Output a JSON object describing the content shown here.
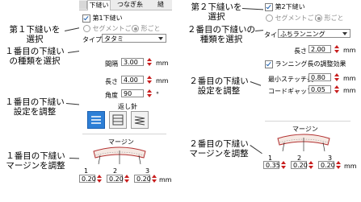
{
  "callouts": {
    "left_1": [
      "第１下縫いを",
      "選択"
    ],
    "left_2": [
      "１番目の下縫い",
      "の種類を選択"
    ],
    "left_3": [
      "１番目の下縫い",
      "設定を調整"
    ],
    "left_4": [
      "１番目の下縫い",
      "マージンを調整"
    ],
    "right_1": [
      "第２下縫いを",
      "選択"
    ],
    "right_2": [
      "２番目の下縫いの",
      "種類を選択"
    ],
    "right_3": [
      "２番目の下縫い",
      "設定を調整"
    ],
    "right_4": [
      "２番目の下縫い",
      "マージンを調整"
    ]
  },
  "panel1": {
    "tabs": [
      "下縫い",
      "つなぎ糸",
      "縫"
    ],
    "underlay_checkbox": "第1下縫い",
    "radio_segment": "セグメントごと",
    "radio_shape": "形ごと",
    "type_label": "タイプ:",
    "type_value": "タタミ",
    "spacing_label": "間隔",
    "spacing_value": "3.00",
    "length_label": "長さ",
    "length_value": "4.00",
    "angle_label": "角度",
    "angle_value": "90",
    "unit_mm": "mm",
    "degree_unit": "°",
    "backstitch_label": "返し針",
    "margin_label": "マージン",
    "margin_numbers": [
      "1",
      "2",
      "3"
    ],
    "margin_values": [
      "0.20",
      "0.20",
      "0.20"
    ]
  },
  "panel2": {
    "underlay_checkbox": "第2下縫い",
    "radio_segment": "セグメントごと",
    "radio_shape": "形ごと",
    "type_label": "タイプ:",
    "type_value": "ふちランニング",
    "length_label": "長さ",
    "length_value": "2.00",
    "run_effect_checkbox": "ランニング長の調整効果",
    "min_stitch_label": "最小ステッチ長",
    "min_stitch_value": "0.80",
    "corner_gap_label": "コードギャップ:",
    "corner_gap_value": "0.05",
    "unit_mm": "mm",
    "margin_label": "マージン",
    "margin_numbers": [
      "1",
      "2",
      "3"
    ],
    "margin_values": [
      "0.35",
      "0.20",
      "0.20"
    ]
  }
}
